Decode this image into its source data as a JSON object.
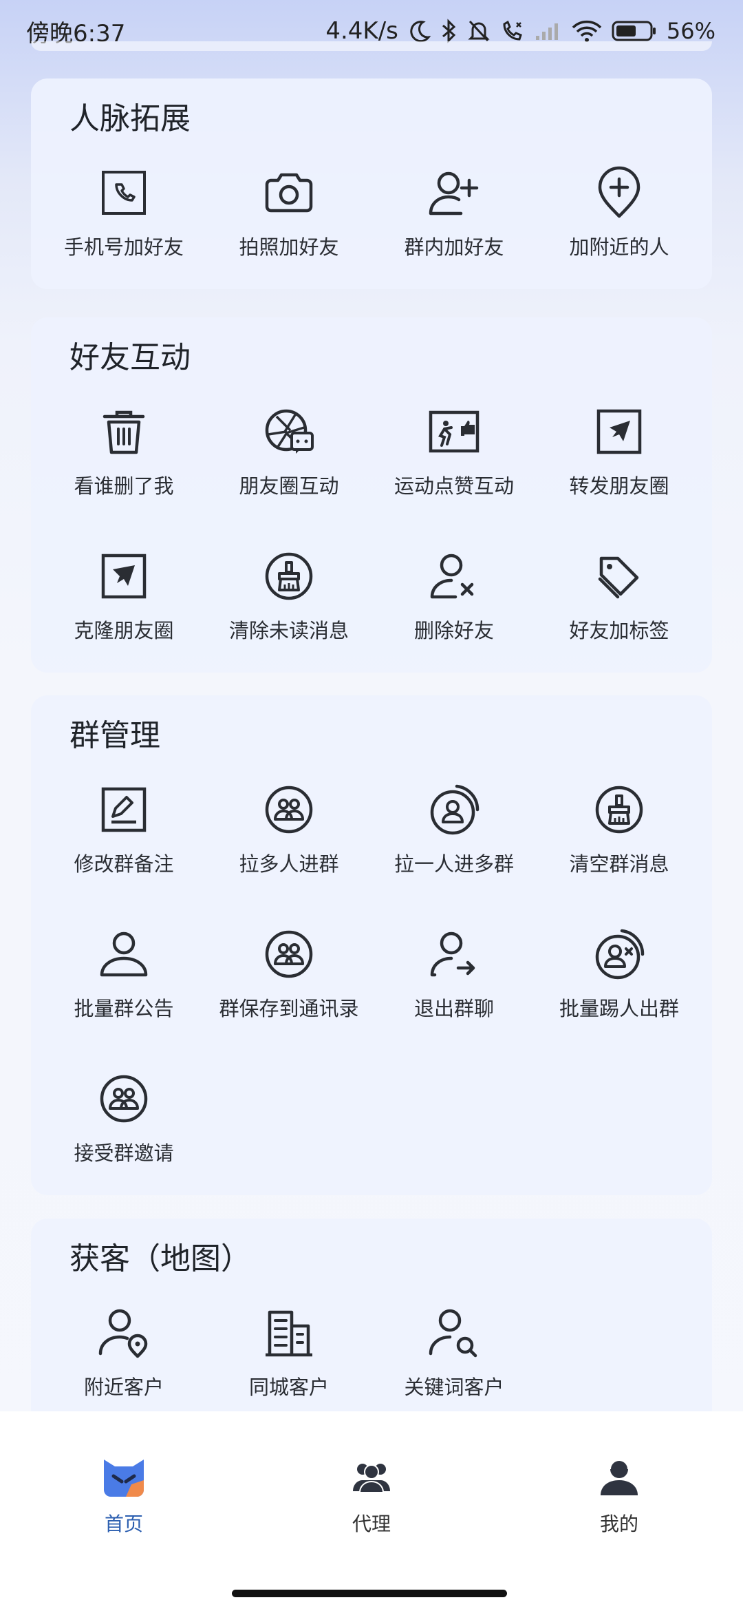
{
  "status_bar": {
    "time": "傍晚6:37",
    "speed": "4.4K/s",
    "battery": "56%"
  },
  "sections": [
    {
      "title": "人脉拓展",
      "items": [
        {
          "label": "手机号加好友",
          "icon": "phone-square-icon"
        },
        {
          "label": "拍照加好友",
          "icon": "camera-icon"
        },
        {
          "label": "群内加好友",
          "icon": "user-plus-icon"
        },
        {
          "label": "加附近的人",
          "icon": "location-plus-icon"
        }
      ]
    },
    {
      "title": "好友互动",
      "items": [
        {
          "label": "看谁删了我",
          "icon": "trash-icon"
        },
        {
          "label": "朋友圈互动",
          "icon": "moments-chat-icon"
        },
        {
          "label": "运动点赞互动",
          "icon": "sport-like-icon"
        },
        {
          "label": "转发朋友圈",
          "icon": "forward-square-icon"
        },
        {
          "label": "克隆朋友圈",
          "icon": "clone-square-icon"
        },
        {
          "label": "清除未读消息",
          "icon": "broom-circle-icon"
        },
        {
          "label": "删除好友",
          "icon": "user-remove-icon"
        },
        {
          "label": "好友加标签",
          "icon": "tags-icon"
        }
      ]
    },
    {
      "title": "群管理",
      "items": [
        {
          "label": "修改群备注",
          "icon": "edit-square-icon"
        },
        {
          "label": "拉多人进群",
          "icon": "group-circle-icon"
        },
        {
          "label": "拉一人进多群",
          "icon": "user-circle-arc-icon"
        },
        {
          "label": "清空群消息",
          "icon": "broom-circle-icon"
        },
        {
          "label": "批量群公告",
          "icon": "user-outline-icon"
        },
        {
          "label": "群保存到通讯录",
          "icon": "group-circle-icon"
        },
        {
          "label": "退出群聊",
          "icon": "user-exit-icon"
        },
        {
          "label": "批量踢人出群",
          "icon": "user-circle-x-icon"
        },
        {
          "label": "接受群邀请",
          "icon": "group-circle-icon"
        }
      ]
    },
    {
      "title": "获客（地图）",
      "items": [
        {
          "label": "附近客户",
          "icon": "user-location-icon"
        },
        {
          "label": "同城客户",
          "icon": "buildings-icon"
        },
        {
          "label": "关键词客户",
          "icon": "user-search-icon"
        }
      ]
    }
  ],
  "bottom_nav": [
    {
      "label": "首页",
      "icon": "home-logo-icon",
      "active": true
    },
    {
      "label": "代理",
      "icon": "agents-icon",
      "active": false
    },
    {
      "label": "我的",
      "icon": "profile-icon",
      "active": false
    }
  ],
  "colors": {
    "icon_stroke": "#2a2d33",
    "active_nav": "#2c5fb0",
    "card_bg": "#eef2fe"
  }
}
